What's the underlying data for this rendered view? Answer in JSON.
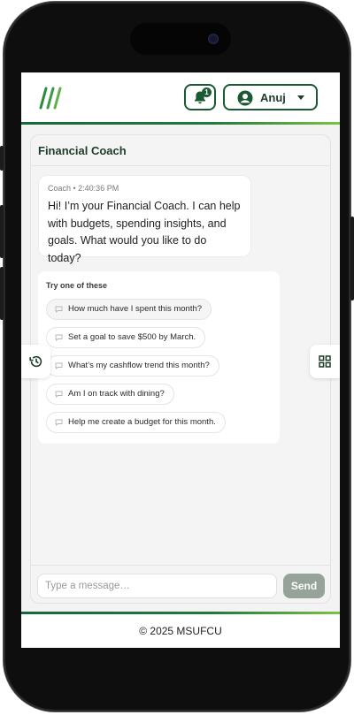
{
  "header": {
    "notification_count": "1",
    "user_name": "Anuj"
  },
  "card": {
    "title": "Financial Coach"
  },
  "message": {
    "meta": "Coach • 2:40:36 PM",
    "text": "Hi! I’m your Financial Coach. I can help with budgets, spending insights, and goals. What would you like to do today?"
  },
  "suggestions": {
    "title": "Try one of these",
    "items": [
      "How much have I spent this month?",
      "Set a goal to save $500 by March.",
      "What’s my cashflow trend this month?",
      "Am I on track with dining?",
      "Help me create a budget for this month."
    ]
  },
  "composer": {
    "placeholder": "Type a message…",
    "send_label": "Send"
  },
  "footer": {
    "text": "© 2025 MSUFCU"
  },
  "colors": {
    "brand_dark": "#1a5a33",
    "brand_green": "#1f7a3c",
    "brand_light": "#7cc242",
    "send_disabled": "#95a39a"
  },
  "icons": [
    "logo-slashes-icon",
    "bell-icon",
    "user-circle-icon",
    "caret-down-icon",
    "chat-bubble-icon",
    "history-icon",
    "grid-icon"
  ]
}
